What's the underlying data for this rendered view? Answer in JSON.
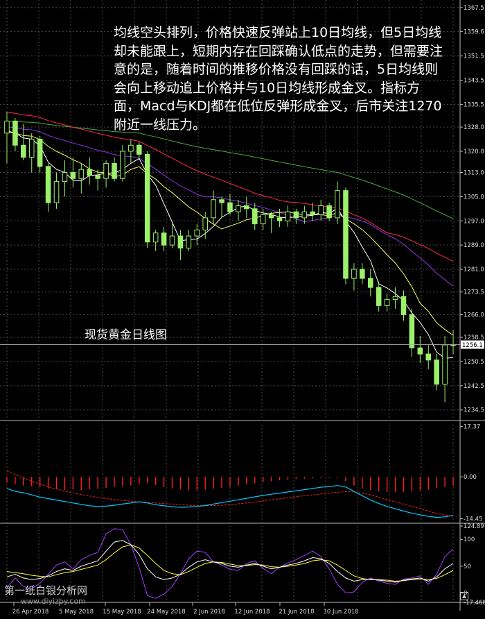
{
  "note_text": "均线空头排列，价格快速反弹站上10日均线，但5日均线却未能跟上，短期内存在回踩确认低点的走势，但需要注意的是，随着时间的推移价格没有回踩的话，5日均线则会向上移动追上价格并与10日均线形成金叉。指标方面，Macd与KDJ都在低位反弹形成金叉，后市关注1270附近一线压力。",
  "watermark": {
    "name": "第一纸白银分析网",
    "url": "www.diyizby.com"
  },
  "colors": {
    "background": "#000000",
    "grid": "#4a4a4a",
    "candle": "#9cf06a",
    "ma5": "#ffffff",
    "ma10": "#ffff66",
    "ma20": "#8f36e8",
    "ma30": "#ff2a4a",
    "ma60": "#4ea83a",
    "macd_hist_neg": "#ff2020",
    "macd_hist_pos": "#3fa02f",
    "macd_line": "#00c8ff",
    "macd_signal": "#ff2020",
    "kdj_k": "#ffffff",
    "kdj_d": "#ffff33",
    "kdj_j": "#a040ff"
  },
  "chart_data": {
    "type": "candlestick",
    "title": "现货黄金日线图",
    "x_labels": [
      "26 Apr 2018",
      "5 May 2018",
      "15 May 2018",
      "24 May 2018",
      "2 Jun 2018",
      "12 Jun 2018",
      "21 Jun 2018",
      "30 Jun 2018"
    ],
    "price_axis": {
      "ylim": [
        1231.0,
        1370.0
      ],
      "ticks": [
        "1367.5",
        "1359.6",
        "1351.5",
        "1343.5",
        "1335.5",
        "1328.0",
        "1320.0",
        "1313.0",
        "1305.0",
        "1297.0",
        "1289.0",
        "1281.0",
        "1273.5",
        "1266.0",
        "1258.5",
        "1250.5",
        "1242.5",
        "1234.5"
      ],
      "current_price": "1256.1",
      "current_value": 1256.1
    },
    "candles": [
      {
        "o": 1326,
        "h": 1333,
        "l": 1316,
        "c": 1330
      },
      {
        "o": 1330,
        "h": 1331,
        "l": 1320,
        "c": 1322
      },
      {
        "o": 1322,
        "h": 1329,
        "l": 1317,
        "c": 1318
      },
      {
        "o": 1318,
        "h": 1326,
        "l": 1313,
        "c": 1324
      },
      {
        "o": 1324,
        "h": 1325,
        "l": 1313,
        "c": 1315
      },
      {
        "o": 1315,
        "h": 1316,
        "l": 1300,
        "c": 1303
      },
      {
        "o": 1303,
        "h": 1313,
        "l": 1301,
        "c": 1310
      },
      {
        "o": 1310,
        "h": 1317,
        "l": 1305,
        "c": 1313
      },
      {
        "o": 1313,
        "h": 1318,
        "l": 1308,
        "c": 1311
      },
      {
        "o": 1311,
        "h": 1316,
        "l": 1306,
        "c": 1314
      },
      {
        "o": 1314,
        "h": 1318,
        "l": 1309,
        "c": 1312
      },
      {
        "o": 1312,
        "h": 1314,
        "l": 1307,
        "c": 1311
      },
      {
        "o": 1311,
        "h": 1317,
        "l": 1308,
        "c": 1316
      },
      {
        "o": 1316,
        "h": 1318,
        "l": 1310,
        "c": 1311
      },
      {
        "o": 1311,
        "h": 1322,
        "l": 1310,
        "c": 1320
      },
      {
        "o": 1320,
        "h": 1324,
        "l": 1316,
        "c": 1322
      },
      {
        "o": 1322,
        "h": 1323,
        "l": 1317,
        "c": 1319
      },
      {
        "o": 1319,
        "h": 1320,
        "l": 1288,
        "c": 1290
      },
      {
        "o": 1290,
        "h": 1294,
        "l": 1287,
        "c": 1293
      },
      {
        "o": 1293,
        "h": 1295,
        "l": 1287,
        "c": 1289
      },
      {
        "o": 1289,
        "h": 1296,
        "l": 1288,
        "c": 1292
      },
      {
        "o": 1292,
        "h": 1294,
        "l": 1284,
        "c": 1288
      },
      {
        "o": 1288,
        "h": 1294,
        "l": 1287,
        "c": 1292
      },
      {
        "o": 1292,
        "h": 1296,
        "l": 1289,
        "c": 1294
      },
      {
        "o": 1294,
        "h": 1300,
        "l": 1291,
        "c": 1298
      },
      {
        "o": 1298,
        "h": 1307,
        "l": 1296,
        "c": 1304
      },
      {
        "o": 1304,
        "h": 1305,
        "l": 1298,
        "c": 1303
      },
      {
        "o": 1303,
        "h": 1306,
        "l": 1299,
        "c": 1300
      },
      {
        "o": 1300,
        "h": 1304,
        "l": 1297,
        "c": 1302
      },
      {
        "o": 1302,
        "h": 1305,
        "l": 1298,
        "c": 1301
      },
      {
        "o": 1301,
        "h": 1303,
        "l": 1294,
        "c": 1296
      },
      {
        "o": 1296,
        "h": 1301,
        "l": 1294,
        "c": 1299
      },
      {
        "o": 1299,
        "h": 1300,
        "l": 1293,
        "c": 1298
      },
      {
        "o": 1298,
        "h": 1301,
        "l": 1295,
        "c": 1297
      },
      {
        "o": 1297,
        "h": 1302,
        "l": 1295,
        "c": 1300
      },
      {
        "o": 1300,
        "h": 1301,
        "l": 1296,
        "c": 1298
      },
      {
        "o": 1298,
        "h": 1302,
        "l": 1296,
        "c": 1300
      },
      {
        "o": 1300,
        "h": 1303,
        "l": 1297,
        "c": 1299
      },
      {
        "o": 1299,
        "h": 1304,
        "l": 1297,
        "c": 1302
      },
      {
        "o": 1302,
        "h": 1303,
        "l": 1297,
        "c": 1298
      },
      {
        "o": 1298,
        "h": 1310,
        "l": 1296,
        "c": 1307
      },
      {
        "o": 1307,
        "h": 1308,
        "l": 1276,
        "c": 1278
      },
      {
        "o": 1278,
        "h": 1283,
        "l": 1274,
        "c": 1281
      },
      {
        "o": 1281,
        "h": 1283,
        "l": 1276,
        "c": 1278
      },
      {
        "o": 1278,
        "h": 1281,
        "l": 1272,
        "c": 1275
      },
      {
        "o": 1275,
        "h": 1277,
        "l": 1267,
        "c": 1269
      },
      {
        "o": 1269,
        "h": 1273,
        "l": 1267,
        "c": 1271
      },
      {
        "o": 1271,
        "h": 1275,
        "l": 1268,
        "c": 1272
      },
      {
        "o": 1272,
        "h": 1274,
        "l": 1264,
        "c": 1266
      },
      {
        "o": 1266,
        "h": 1268,
        "l": 1252,
        "c": 1255
      },
      {
        "o": 1255,
        "h": 1259,
        "l": 1250,
        "c": 1253
      },
      {
        "o": 1253,
        "h": 1256,
        "l": 1248,
        "c": 1251
      },
      {
        "o": 1251,
        "h": 1253,
        "l": 1241,
        "c": 1243
      },
      {
        "o": 1243,
        "h": 1259,
        "l": 1237,
        "c": 1256
      },
      {
        "o": 1256,
        "h": 1261,
        "l": 1253,
        "c": 1256
      }
    ],
    "macd": {
      "ylim": [
        -16.0,
        18.0
      ],
      "ticks": [
        "17.37",
        "0.00",
        "-14.45"
      ],
      "histogram": [
        -2,
        -2.5,
        -3,
        -3.2,
        -3.5,
        -4,
        -4.2,
        -4.5,
        -4.4,
        -4.6,
        -4.3,
        -4.1,
        -3.8,
        -3.5,
        -3.2,
        -3,
        -2.6,
        -2.2,
        -2.8,
        -3.5,
        -4,
        -4.3,
        -4.5,
        -4.6,
        -4.4,
        -4.1,
        -3.8,
        -3.4,
        -3,
        -2.6,
        -2.2,
        -1.8,
        -1.5,
        -1.2,
        -1,
        -0.8,
        -0.6,
        -0.5,
        -0.4,
        -0.3,
        -0.3,
        -1.5,
        -3,
        -4,
        -4.6,
        -5,
        -5.2,
        -5.3,
        -5.2,
        -5,
        -4.7,
        -4.4,
        -4.0,
        -3.5,
        -3.0
      ],
      "macd_line": [
        -4,
        -5,
        -5.5,
        -6.2,
        -7,
        -7.5,
        -8,
        -8.5,
        -9,
        -9.5,
        -10,
        -10.2,
        -10.1,
        -9.8,
        -9.4,
        -9,
        -8.6,
        -9,
        -9.6,
        -10,
        -10.3,
        -10.5,
        -10.4,
        -10.2,
        -9.9,
        -9.4,
        -8.9,
        -8.4,
        -7.9,
        -7.4,
        -6.9,
        -6.4,
        -6.0,
        -5.6,
        -5.2,
        -4.8,
        -4.4,
        -4.0,
        -3.6,
        -3.3,
        -3,
        -3.5,
        -5,
        -6.5,
        -8,
        -9.2,
        -10.2,
        -11,
        -11.8,
        -12.5,
        -13.1,
        -13.6,
        -14,
        -13.8,
        -13.3
      ],
      "signal_line": [
        2,
        0.8,
        -0.4,
        -1.5,
        -2.5,
        -3.4,
        -4.2,
        -4.9,
        -5.5,
        -6.1,
        -6.6,
        -7.1,
        -7.5,
        -7.8,
        -8.1,
        -8.4,
        -8.6,
        -8.8,
        -9,
        -9.2,
        -9.4,
        -9.6,
        -9.8,
        -9.9,
        -10,
        -9.9,
        -9.8,
        -9.6,
        -9.3,
        -9,
        -8.7,
        -8.3,
        -7.9,
        -7.6,
        -7.2,
        -6.8,
        -6.5,
        -6.2,
        -5.9,
        -5.6,
        -5.3,
        -5.1,
        -5.2,
        -5.6,
        -6.2,
        -7,
        -7.8,
        -8.6,
        -9.4,
        -10.2,
        -11,
        -11.8,
        -12.6,
        -13.2,
        -13.6
      ]
    },
    "kdj": {
      "ylim": [
        -17.468,
        124.891
      ],
      "ticks": [
        "124.891",
        "100",
        "50",
        "0",
        "-17.468"
      ],
      "k": [
        30,
        35,
        28,
        25,
        27,
        32,
        40,
        45,
        42,
        50,
        55,
        60,
        78,
        95,
        98,
        90,
        72,
        45,
        30,
        25,
        28,
        35,
        48,
        58,
        62,
        58,
        55,
        50,
        48,
        52,
        55,
        50,
        45,
        48,
        52,
        55,
        60,
        66,
        64,
        55,
        40,
        28,
        22,
        25,
        26,
        24,
        22,
        20,
        24,
        26,
        28,
        22,
        30,
        45,
        55
      ],
      "d": [
        40,
        38,
        36,
        33,
        31,
        30,
        34,
        38,
        40,
        44,
        48,
        52,
        62,
        75,
        86,
        90,
        84,
        70,
        55,
        42,
        36,
        34,
        40,
        48,
        55,
        58,
        57,
        54,
        51,
        51,
        53,
        52,
        49,
        48,
        50,
        52,
        55,
        60,
        62,
        60,
        52,
        42,
        32,
        27,
        25,
        25,
        24,
        22,
        23,
        25,
        26,
        25,
        27,
        34,
        42
      ],
      "j": [
        10,
        28,
        12,
        8,
        18,
        35,
        52,
        58,
        45,
        62,
        70,
        76,
        110,
        120,
        118,
        90,
        48,
        -5,
        -10,
        -2,
        12,
        36,
        64,
        78,
        76,
        58,
        52,
        44,
        42,
        55,
        60,
        46,
        36,
        48,
        56,
        62,
        70,
        78,
        68,
        45,
        16,
        0,
        2,
        20,
        28,
        22,
        18,
        16,
        26,
        28,
        32,
        16,
        35,
        68,
        82
      ]
    }
  }
}
